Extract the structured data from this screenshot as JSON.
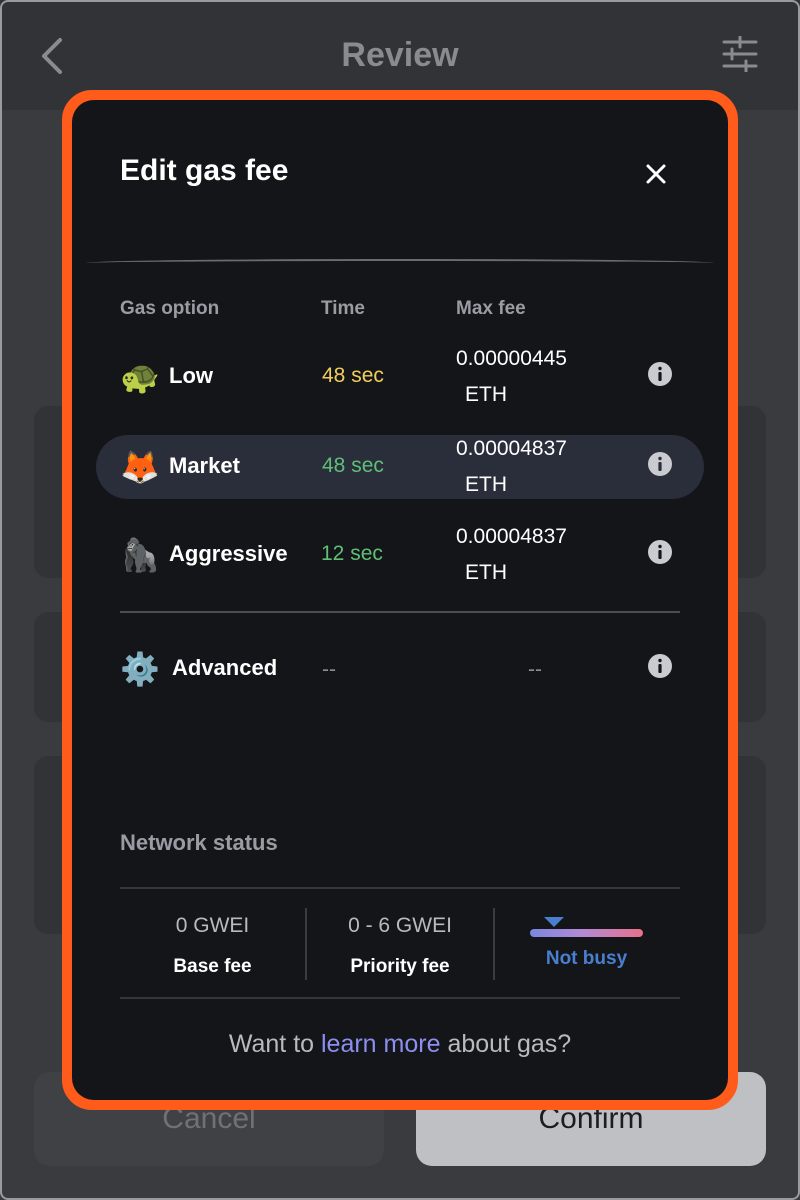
{
  "background": {
    "header_title": "Review",
    "cancel_label": "Cancel",
    "confirm_label": "Confirm"
  },
  "modal": {
    "title": "Edit gas fee",
    "columns": {
      "option": "Gas option",
      "time": "Time",
      "max_fee": "Max fee"
    },
    "options": [
      {
        "emoji": "🐢",
        "name": "Low",
        "time": "48 sec",
        "fee": "0.00000445",
        "unit": "ETH",
        "time_color": "#f2cd5c"
      },
      {
        "emoji": "🦊",
        "name": "Market",
        "time": "48 sec",
        "fee": "0.00004837",
        "unit": "ETH",
        "time_color": "#5fbf77",
        "selected": true
      },
      {
        "emoji": "🦍",
        "name": "Aggressive",
        "time": "12 sec",
        "fee": "0.00004837",
        "unit": "ETH",
        "time_color": "#5fbf77"
      }
    ],
    "advanced": {
      "emoji": "⚙️",
      "name": "Advanced",
      "time": "--",
      "fee": "--"
    },
    "network": {
      "title": "Network status",
      "base_fee_value": "0 GWEI",
      "base_fee_label": "Base fee",
      "priority_fee_value": "0 - 6 GWEI",
      "priority_fee_label": "Priority fee",
      "busy_label": "Not busy"
    },
    "footer": {
      "prefix": "Want to ",
      "link": "learn more",
      "suffix": " about gas?"
    }
  },
  "colors": {
    "accent_outline": "#ff5b1a",
    "link": "#8c8ff0",
    "busy_text": "#4a7fcf"
  }
}
